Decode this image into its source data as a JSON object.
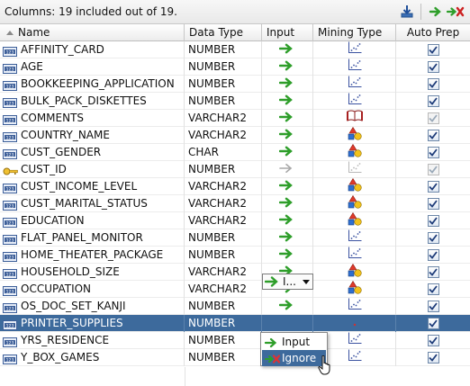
{
  "toolbar": {
    "summary": "Columns: 19 included out of 19.",
    "icons": [
      "download-icon",
      "include-all-icon",
      "exclude-all-icon"
    ]
  },
  "columns_header": {
    "name": "Name",
    "data_type": "Data Type",
    "input": "Input",
    "mining_type": "Mining Type",
    "auto_prep": "Auto Prep"
  },
  "rows": [
    {
      "name": "AFFINITY_CARD",
      "data_type": "NUMBER",
      "icon": "numeric-column-icon",
      "input": "input",
      "mining": "numerical",
      "auto_prep": true
    },
    {
      "name": "AGE",
      "data_type": "NUMBER",
      "icon": "numeric-column-icon",
      "input": "input",
      "mining": "numerical",
      "auto_prep": true
    },
    {
      "name": "BOOKKEEPING_APPLICATION",
      "data_type": "NUMBER",
      "icon": "numeric-column-icon",
      "input": "input",
      "mining": "numerical",
      "auto_prep": true
    },
    {
      "name": "BULK_PACK_DISKETTES",
      "data_type": "NUMBER",
      "icon": "numeric-column-icon",
      "input": "input",
      "mining": "numerical",
      "auto_prep": true
    },
    {
      "name": "COMMENTS",
      "data_type": "VARCHAR2",
      "icon": "numeric-column-icon",
      "input": "input",
      "mining": "text",
      "auto_prep": true,
      "prep_disabled": true
    },
    {
      "name": "COUNTRY_NAME",
      "data_type": "VARCHAR2",
      "icon": "numeric-column-icon",
      "input": "input",
      "mining": "categorical",
      "auto_prep": true
    },
    {
      "name": "CUST_GENDER",
      "data_type": "CHAR",
      "icon": "numeric-column-icon",
      "input": "input",
      "mining": "categorical",
      "auto_prep": true
    },
    {
      "name": "CUST_ID",
      "data_type": "NUMBER",
      "icon": "key-icon",
      "input": "disabled",
      "mining": "numerical-disabled",
      "auto_prep": true,
      "prep_disabled": true
    },
    {
      "name": "CUST_INCOME_LEVEL",
      "data_type": "VARCHAR2",
      "icon": "numeric-column-icon",
      "input": "input",
      "mining": "categorical",
      "auto_prep": true
    },
    {
      "name": "CUST_MARITAL_STATUS",
      "data_type": "VARCHAR2",
      "icon": "numeric-column-icon",
      "input": "input",
      "mining": "categorical",
      "auto_prep": true
    },
    {
      "name": "EDUCATION",
      "data_type": "VARCHAR2",
      "icon": "numeric-column-icon",
      "input": "input",
      "mining": "categorical",
      "auto_prep": true
    },
    {
      "name": "FLAT_PANEL_MONITOR",
      "data_type": "NUMBER",
      "icon": "numeric-column-icon",
      "input": "input",
      "mining": "numerical",
      "auto_prep": true
    },
    {
      "name": "HOME_THEATER_PACKAGE",
      "data_type": "NUMBER",
      "icon": "numeric-column-icon",
      "input": "input",
      "mining": "numerical",
      "auto_prep": true
    },
    {
      "name": "HOUSEHOLD_SIZE",
      "data_type": "VARCHAR2",
      "icon": "numeric-column-icon",
      "input": "input",
      "mining": "categorical",
      "auto_prep": true
    },
    {
      "name": "OCCUPATION",
      "data_type": "VARCHAR2",
      "icon": "numeric-column-icon",
      "input": "input",
      "mining": "categorical",
      "auto_prep": true
    },
    {
      "name": "OS_DOC_SET_KANJI",
      "data_type": "NUMBER",
      "icon": "numeric-column-icon",
      "input": "input",
      "mining": "numerical",
      "auto_prep": true
    },
    {
      "name": "PRINTER_SUPPLIES",
      "data_type": "NUMBER",
      "icon": "numeric-column-icon",
      "input": "combo",
      "mining": "numerical",
      "auto_prep": true,
      "selected": true
    },
    {
      "name": "YRS_RESIDENCE",
      "data_type": "NUMBER",
      "icon": "numeric-column-icon",
      "input": "none",
      "mining": "numerical",
      "auto_prep": true
    },
    {
      "name": "Y_BOX_GAMES",
      "data_type": "NUMBER",
      "icon": "numeric-column-icon",
      "input": "none",
      "mining": "numerical",
      "auto_prep": true
    }
  ],
  "combo": {
    "value": "I..."
  },
  "dropdown": {
    "options": [
      {
        "label": "Input",
        "icon": "input-arrow-icon"
      },
      {
        "label": "Ignore",
        "icon": "ignore-icon",
        "selected": true
      }
    ]
  },
  "colors": {
    "selection": "#3d6a9c",
    "arrow_green": "#2e9e2a",
    "ignore_red": "#cc2222"
  }
}
